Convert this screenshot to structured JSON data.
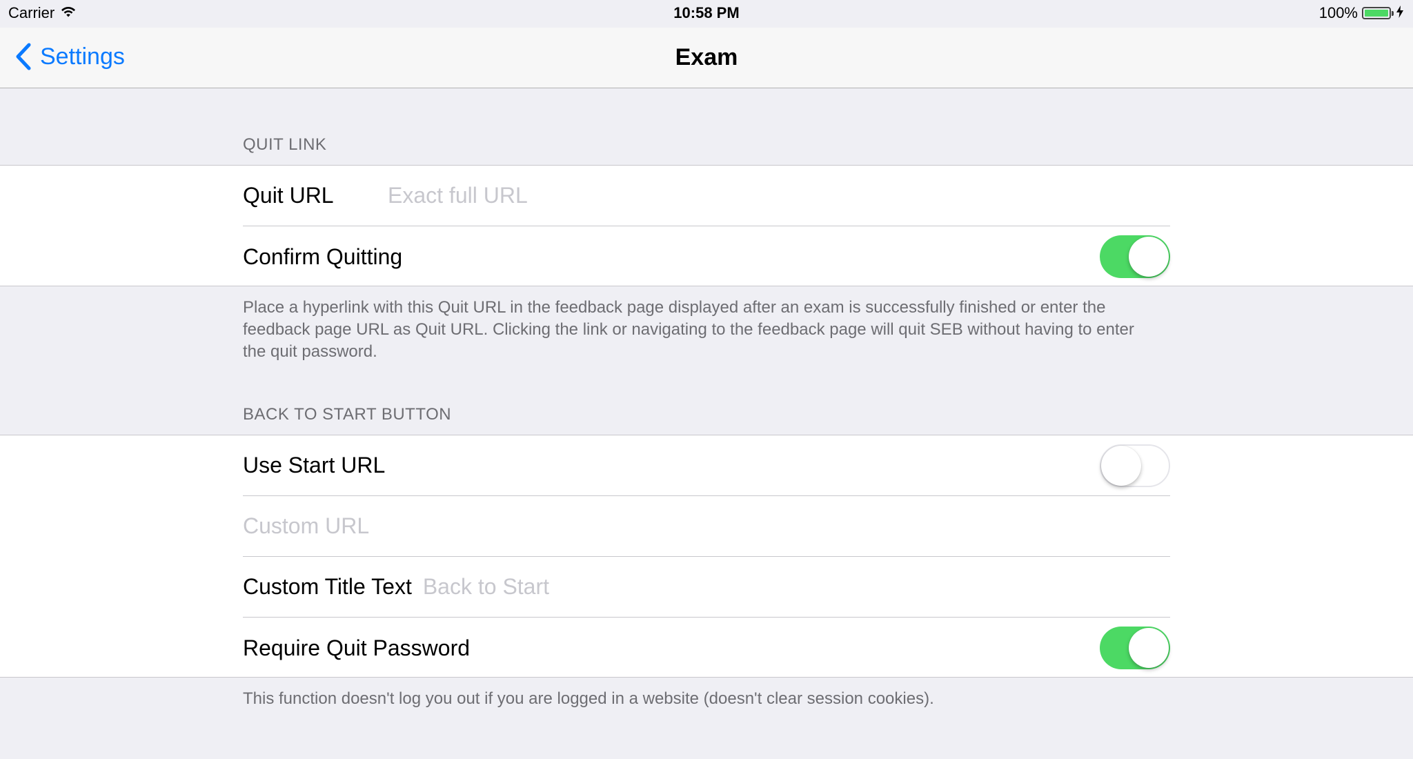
{
  "status_bar": {
    "carrier": "Carrier",
    "time": "10:58 PM",
    "battery": "100%"
  },
  "nav": {
    "back_label": "Settings",
    "title": "Exam"
  },
  "quit_link": {
    "header": "QUIT LINK",
    "quit_url_label": "Quit URL",
    "quit_url_placeholder": "Exact full URL",
    "confirm_quitting_label": "Confirm Quitting",
    "confirm_quitting_on": true,
    "footer": "Place a hyperlink with this Quit URL in the feedback page displayed after an exam is successfully finished or enter the feedback page URL as Quit URL. Clicking the link or navigating to the feedback page will quit SEB without having to enter the quit password."
  },
  "back_to_start": {
    "header": "BACK TO START BUTTON",
    "use_start_url_label": "Use Start URL",
    "use_start_url_on": false,
    "custom_url_placeholder": "Custom URL",
    "custom_title_label": "Custom Title Text",
    "custom_title_placeholder": "Back to Start",
    "require_quit_password_label": "Require Quit Password",
    "require_quit_password_on": true,
    "footer": "This function doesn't log you out if you are logged in a website (doesn't clear session cookies)."
  },
  "colors": {
    "accent": "#0a7aff",
    "toggle_on": "#4cd964",
    "background": "#efeff4"
  }
}
